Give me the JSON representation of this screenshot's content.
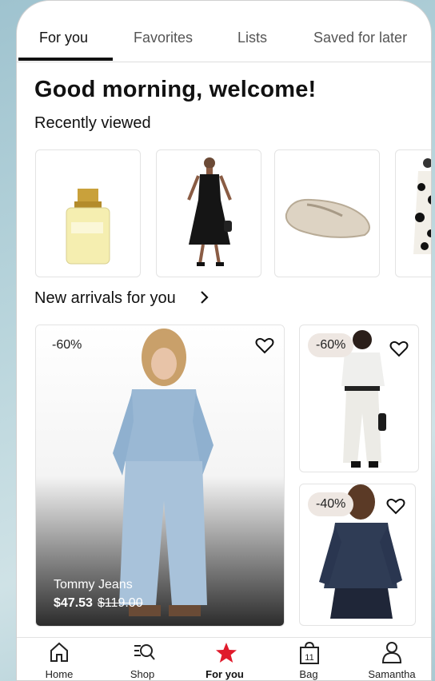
{
  "tabs": [
    "For you",
    "Favorites",
    "Lists",
    "Saved for later"
  ],
  "greeting": "Good morning, welcome!",
  "recently_viewed": {
    "title": "Recently viewed",
    "items": [
      {
        "icon": "perfume-image"
      },
      {
        "icon": "black-dress-image"
      },
      {
        "icon": "lace-flat-shoe-image"
      },
      {
        "icon": "print-dress-image"
      }
    ]
  },
  "new_arrivals": {
    "title": "New arrivals for you",
    "products": [
      {
        "discount": "-60%",
        "brand": "Tommy Jeans",
        "price": "$47.53",
        "original_price": "$119.00"
      },
      {
        "discount": "-60%"
      },
      {
        "discount": "-40%"
      }
    ]
  },
  "nav": [
    {
      "label": "Home",
      "icon": "home-icon"
    },
    {
      "label": "Shop",
      "icon": "shop-search-icon"
    },
    {
      "label": "For you",
      "icon": "star-icon",
      "active": true
    },
    {
      "label": "Bag",
      "icon": "bag-icon",
      "count": "11"
    },
    {
      "label": "Samantha",
      "icon": "profile-icon"
    }
  ],
  "colors": {
    "accent": "#e01a2b",
    "text": "#111111"
  }
}
